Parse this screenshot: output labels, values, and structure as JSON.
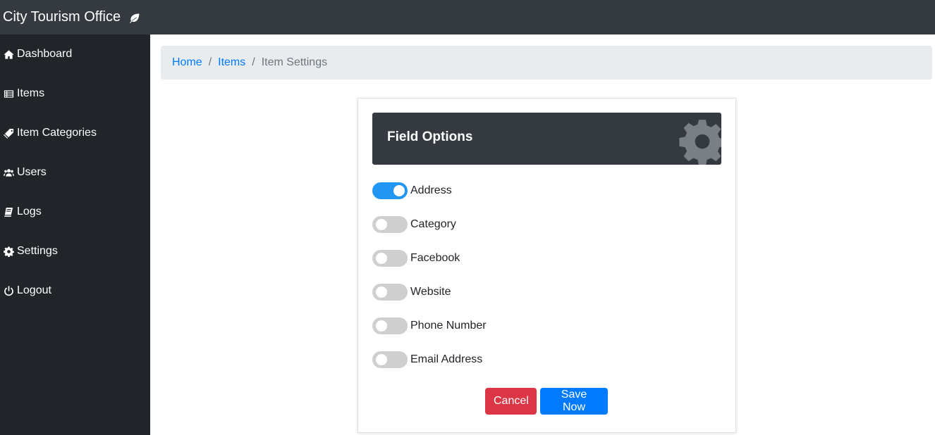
{
  "app": {
    "title": "City Tourism Office"
  },
  "sidebar": {
    "items": [
      {
        "label": "Dashboard",
        "icon": "home-icon"
      },
      {
        "label": "Items",
        "icon": "list-icon"
      },
      {
        "label": "Item Categories",
        "icon": "tags-icon"
      },
      {
        "label": "Users",
        "icon": "users-icon"
      },
      {
        "label": "Logs",
        "icon": "book-icon"
      },
      {
        "label": "Settings",
        "icon": "gear-icon"
      },
      {
        "label": "Logout",
        "icon": "power-icon"
      }
    ]
  },
  "breadcrumb": {
    "home": "Home",
    "items": "Items",
    "current": "Item Settings",
    "separator": "/"
  },
  "card": {
    "title": "Field Options",
    "options": [
      {
        "label": "Address",
        "enabled": true
      },
      {
        "label": "Category",
        "enabled": false
      },
      {
        "label": "Facebook",
        "enabled": false
      },
      {
        "label": "Website",
        "enabled": false
      },
      {
        "label": "Phone Number",
        "enabled": false
      },
      {
        "label": "Email Address",
        "enabled": false
      }
    ],
    "cancel_label": "Cancel",
    "save_label": "Save Now"
  },
  "colors": {
    "topbar": "#343a40",
    "sidebar": "#212529",
    "toggle_on": "#2196f3",
    "cancel": "#dc3545",
    "save": "#007bff"
  }
}
